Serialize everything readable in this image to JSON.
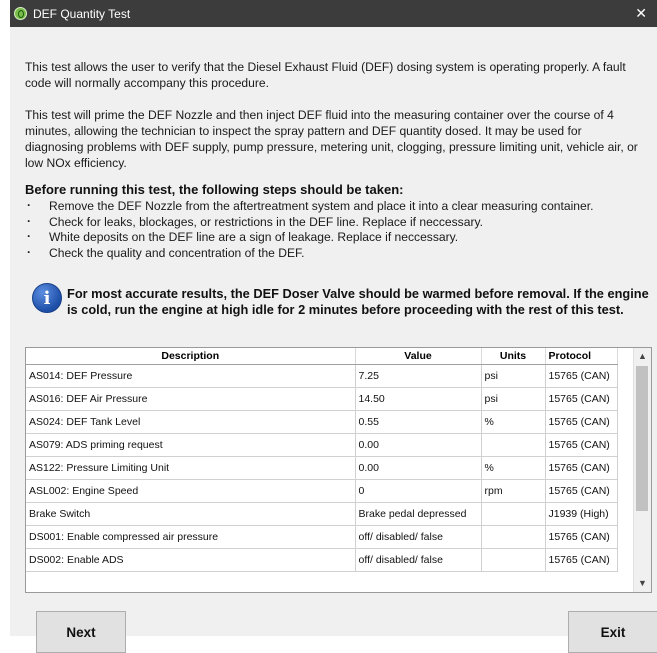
{
  "window": {
    "title": "DEF Quantity Test",
    "close_glyph": "✕"
  },
  "intro": {
    "paragraph1": "This test allows the user to verify that the Diesel Exhaust Fluid (DEF) dosing system is operating properly. A fault code will normally accompany this procedure.",
    "paragraph2": "This test will prime the DEF Nozzle and then inject DEF fluid into the measuring container over the course of 4 minutes, allowing the technician to inspect the spray pattern and DEF quantity dosed. It may be used for diagnosing problems with DEF supply, pump pressure, metering unit, clogging, pressure limiting unit, vehicle air, or low NOx efficiency."
  },
  "steps": {
    "heading": "Before running this test, the following steps should be taken:",
    "items": [
      "Remove the DEF Nozzle from the aftertreatment system and place it into a clear measuring container.",
      "Check for leaks, blockages, or restrictions in the DEF line.  Replace if neccessary.",
      "White deposits on the DEF line are a sign of leakage. Replace if neccessary.",
      "Check the quality and concentration of the DEF."
    ]
  },
  "info": {
    "icon": "info-icon",
    "icon_glyph": "i",
    "text": "For most accurate results, the DEF Doser Valve should be warmed before removal. If the engine is cold, run the engine at high idle for 2 minutes before proceeding with the rest of this test."
  },
  "table": {
    "headers": {
      "description": "Description",
      "value": "Value",
      "units": "Units",
      "protocol": "Protocol"
    },
    "rows": [
      {
        "description": "AS014: DEF Pressure",
        "value": "7.25",
        "units": "psi",
        "protocol": "15765 (CAN)"
      },
      {
        "description": "AS016: DEF Air Pressure",
        "value": "14.50",
        "units": "psi",
        "protocol": "15765 (CAN)"
      },
      {
        "description": "AS024: DEF Tank Level",
        "value": "0.55",
        "units": "%",
        "protocol": "15765 (CAN)"
      },
      {
        "description": "AS079: ADS priming request",
        "value": "0.00",
        "units": "",
        "protocol": "15765 (CAN)"
      },
      {
        "description": "AS122: Pressure Limiting Unit",
        "value": "0.00",
        "units": "%",
        "protocol": "15765 (CAN)"
      },
      {
        "description": "ASL002: Engine Speed",
        "value": "0",
        "units": "rpm",
        "protocol": "15765 (CAN)"
      },
      {
        "description": "Brake Switch",
        "value": "Brake pedal depressed",
        "units": "",
        "protocol": "J1939 (High)"
      },
      {
        "description": "DS001: Enable compressed air pressure",
        "value": "off/ disabled/ false",
        "units": "",
        "protocol": "15765 (CAN)"
      },
      {
        "description": "DS002: Enable ADS",
        "value": "off/ disabled/ false",
        "units": "",
        "protocol": "15765 (CAN)"
      }
    ],
    "scroll_up_glyph": "▲",
    "scroll_down_glyph": "▼"
  },
  "buttons": {
    "next": "Next",
    "exit": "Exit"
  },
  "colors": {
    "titlebar": "#3c3c3c",
    "dialog_bg": "#f0f0f0",
    "info_icon": "#1e4fa8"
  }
}
